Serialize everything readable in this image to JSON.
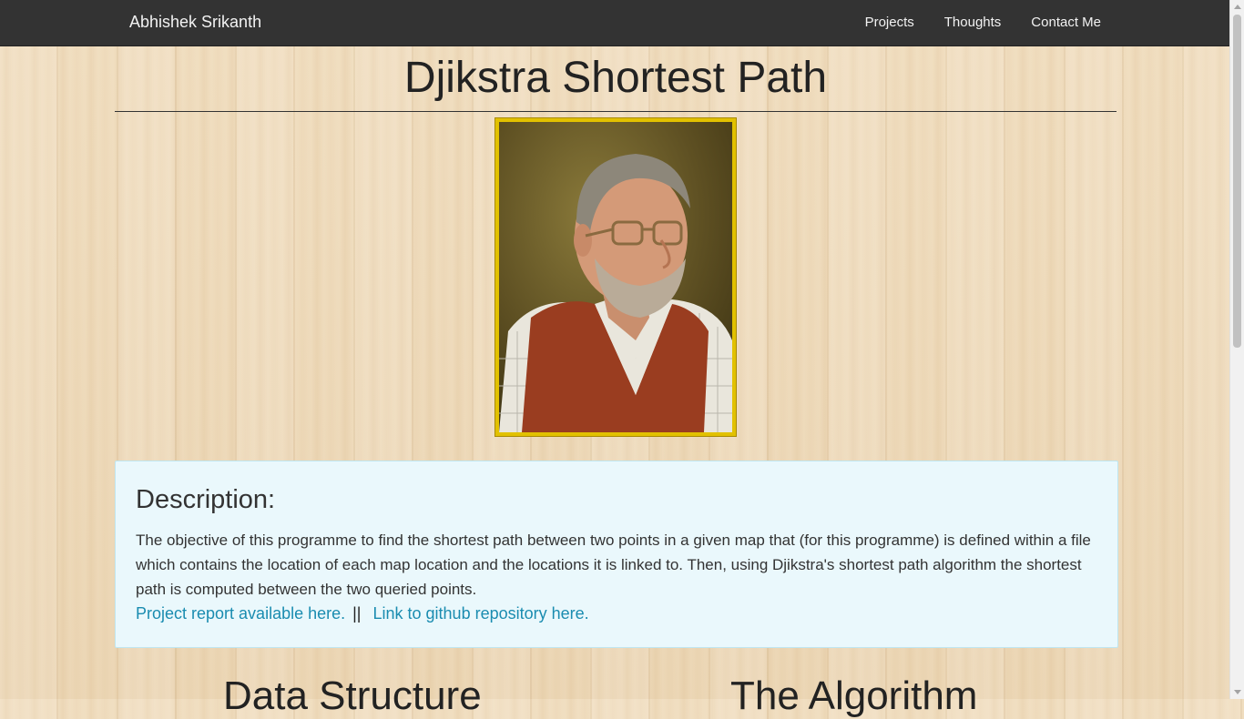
{
  "navbar": {
    "brand": "Abhishek Srikanth",
    "links": [
      {
        "label": "Projects"
      },
      {
        "label": "Thoughts"
      },
      {
        "label": "Contact Me"
      }
    ]
  },
  "page": {
    "title": "Djikstra Shortest Path",
    "portrait_icon": "person-portrait-photo"
  },
  "description": {
    "heading": "Description:",
    "text": "The objective of this programme to find the shortest path between two points in a given map that (for this programme) is defined within a file which contains the location of each map location and the locations it is linked to. Then, using Djikstra's shortest path algorithm the shortest path is computed between the two queried points.",
    "report_link": "Project report available here.",
    "separator": "||",
    "github_link": "Link to github repository here."
  },
  "sections": {
    "data_structure": "Data Structure",
    "algorithm": "The Algorithm"
  },
  "colors": {
    "navbar": "#333333",
    "link": "#1a8cb0",
    "panel": "#eaf8fc",
    "frame": "#e2c100"
  }
}
